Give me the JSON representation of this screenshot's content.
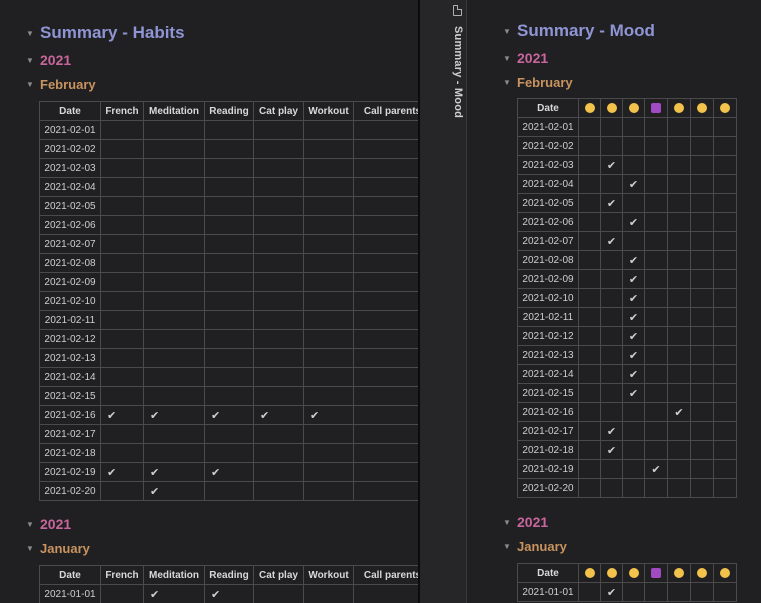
{
  "left_pane": {
    "title": "Summary - Habits",
    "sections": [
      {
        "year": "2021",
        "month": "February",
        "columns": [
          "Date",
          "French",
          "Meditation",
          "Reading",
          "Cat play",
          "Workout",
          "Call parents"
        ],
        "rows": [
          [
            "2021-02-01",
            "",
            "",
            "",
            "",
            "",
            ""
          ],
          [
            "2021-02-02",
            "",
            "",
            "",
            "",
            "",
            ""
          ],
          [
            "2021-02-03",
            "",
            "",
            "",
            "",
            "",
            ""
          ],
          [
            "2021-02-04",
            "",
            "",
            "",
            "",
            "",
            ""
          ],
          [
            "2021-02-05",
            "",
            "",
            "",
            "",
            "",
            ""
          ],
          [
            "2021-02-06",
            "",
            "",
            "",
            "",
            "",
            ""
          ],
          [
            "2021-02-07",
            "",
            "",
            "",
            "",
            "",
            ""
          ],
          [
            "2021-02-08",
            "",
            "",
            "",
            "",
            "",
            ""
          ],
          [
            "2021-02-09",
            "",
            "",
            "",
            "",
            "",
            ""
          ],
          [
            "2021-02-10",
            "",
            "",
            "",
            "",
            "",
            ""
          ],
          [
            "2021-02-11",
            "",
            "",
            "",
            "",
            "",
            ""
          ],
          [
            "2021-02-12",
            "",
            "",
            "",
            "",
            "",
            ""
          ],
          [
            "2021-02-13",
            "",
            "",
            "",
            "",
            "",
            ""
          ],
          [
            "2021-02-14",
            "",
            "",
            "",
            "",
            "",
            ""
          ],
          [
            "2021-02-15",
            "",
            "",
            "",
            "",
            "",
            ""
          ],
          [
            "2021-02-16",
            "✔",
            "✔",
            "✔",
            "✔",
            "✔",
            ""
          ],
          [
            "2021-02-17",
            "",
            "",
            "",
            "",
            "",
            ""
          ],
          [
            "2021-02-18",
            "",
            "",
            "",
            "",
            "",
            ""
          ],
          [
            "2021-02-19",
            "✔",
            "✔",
            "✔",
            "",
            "",
            ""
          ],
          [
            "2021-02-20",
            "",
            "✔",
            "",
            "",
            "",
            ""
          ]
        ]
      },
      {
        "year": "2021",
        "month": "January",
        "columns": [
          "Date",
          "French",
          "Meditation",
          "Reading",
          "Cat play",
          "Workout",
          "Call parents"
        ],
        "rows": [
          [
            "2021-01-01",
            "",
            "✔",
            "✔",
            "",
            "",
            ""
          ]
        ]
      }
    ]
  },
  "tab": {
    "label": "Summary - Mood",
    "icon": "document-icon"
  },
  "right_pane": {
    "title": "Summary - Mood",
    "mood_icons": [
      "slightly-smiling-face",
      "expressionless-face",
      "neutral-face",
      "person-facepalming",
      "smiling-face",
      "worried-face",
      "nerd-face"
    ],
    "sections": [
      {
        "year": "2021",
        "month": "February",
        "date_header": "Date",
        "rows": [
          [
            "2021-02-01",
            "",
            "",
            "",
            "",
            "",
            "",
            ""
          ],
          [
            "2021-02-02",
            "",
            "",
            "",
            "",
            "",
            "",
            ""
          ],
          [
            "2021-02-03",
            "",
            "✔",
            "",
            "",
            "",
            "",
            ""
          ],
          [
            "2021-02-04",
            "",
            "",
            "✔",
            "",
            "",
            "",
            ""
          ],
          [
            "2021-02-05",
            "",
            "✔",
            "",
            "",
            "",
            "",
            ""
          ],
          [
            "2021-02-06",
            "",
            "",
            "✔",
            "",
            "",
            "",
            ""
          ],
          [
            "2021-02-07",
            "",
            "✔",
            "",
            "",
            "",
            "",
            ""
          ],
          [
            "2021-02-08",
            "",
            "",
            "✔",
            "",
            "",
            "",
            ""
          ],
          [
            "2021-02-09",
            "",
            "",
            "✔",
            "",
            "",
            "",
            ""
          ],
          [
            "2021-02-10",
            "",
            "",
            "✔",
            "",
            "",
            "",
            ""
          ],
          [
            "2021-02-11",
            "",
            "",
            "✔",
            "",
            "",
            "",
            ""
          ],
          [
            "2021-02-12",
            "",
            "",
            "✔",
            "",
            "",
            "",
            ""
          ],
          [
            "2021-02-13",
            "",
            "",
            "✔",
            "",
            "",
            "",
            ""
          ],
          [
            "2021-02-14",
            "",
            "",
            "✔",
            "",
            "",
            "",
            ""
          ],
          [
            "2021-02-15",
            "",
            "",
            "✔",
            "",
            "",
            "",
            ""
          ],
          [
            "2021-02-16",
            "",
            "",
            "",
            "",
            "✔",
            "",
            ""
          ],
          [
            "2021-02-17",
            "",
            "✔",
            "",
            "",
            "",
            "",
            ""
          ],
          [
            "2021-02-18",
            "",
            "✔",
            "",
            "",
            "",
            "",
            ""
          ],
          [
            "2021-02-19",
            "",
            "",
            "",
            "✔",
            "",
            "",
            ""
          ],
          [
            "2021-02-20",
            "",
            "",
            "",
            "",
            "",
            "",
            ""
          ]
        ]
      },
      {
        "year": "2021",
        "month": "January",
        "date_header": "Date",
        "rows": [
          [
            "2021-01-01",
            "",
            "✔",
            "",
            "",
            "",
            "",
            ""
          ]
        ]
      }
    ]
  }
}
